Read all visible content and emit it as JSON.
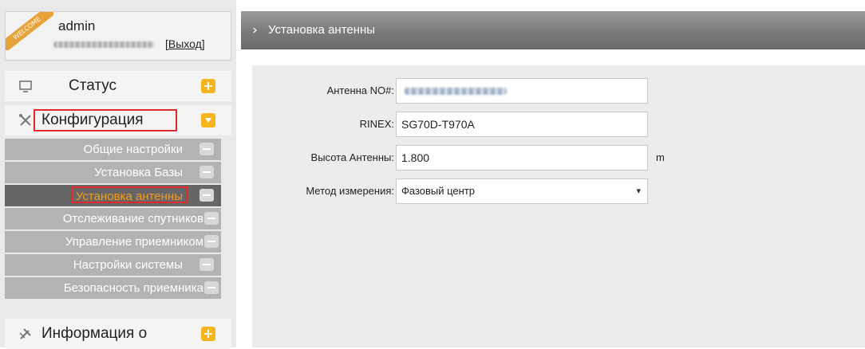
{
  "user": {
    "welcome_badge": "WELCOME",
    "username": "admin",
    "logout_open": "[",
    "logout_label": "Выход",
    "logout_close": "]"
  },
  "menu": {
    "status": {
      "label": "Статус",
      "icon": "monitor-icon",
      "toggle": "+"
    },
    "config": {
      "label": "Конфигурация",
      "icon": "tools-icon",
      "state": "expanded"
    },
    "info": {
      "label": "Информация о",
      "icon": "satellite-icon",
      "toggle": "+"
    },
    "submenu": [
      {
        "label": "Общие настройки"
      },
      {
        "label": "Установка Базы"
      },
      {
        "label": "Установка антенны",
        "active": true
      },
      {
        "label": "Отслеживание спутников"
      },
      {
        "label": "Управление приемником"
      },
      {
        "label": "Настройки системы"
      },
      {
        "label": "Безопасность приемника"
      }
    ]
  },
  "page": {
    "title": "Установка антенны"
  },
  "form": {
    "antenna_no_label": "Антенна NO#:",
    "rinex_label": "RINEX:",
    "rinex_value": "SG70D-T970A",
    "height_label": "Высота Антенны:",
    "height_value": "1.800",
    "height_unit": "m",
    "method_label": "Метод измерения:",
    "method_value": "Фазовый центр"
  },
  "colors": {
    "accent_orange": "#f5b51f",
    "active_text": "#f59b1d",
    "highlight_red": "#e02a2a",
    "header_gray": "#7a7a7a"
  }
}
